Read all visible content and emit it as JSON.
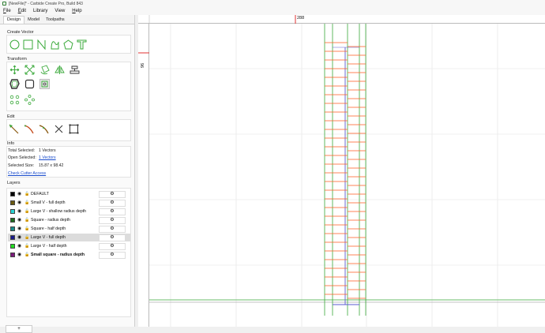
{
  "window": {
    "title": "[NewFile]* - Carbide Create Pro, Build 843"
  },
  "menu": [
    {
      "accel": "F",
      "rest": "ile"
    },
    {
      "accel": "E",
      "rest": "dit"
    },
    {
      "accel": "",
      "rest": "Library"
    },
    {
      "accel": "",
      "rest": "View"
    },
    {
      "accel": "H",
      "rest": "elp"
    }
  ],
  "tabs": [
    "Design",
    "Model",
    "Toolpaths"
  ],
  "sections": {
    "create_vector": "Create Vector",
    "transform": "Transform",
    "edit": "Edit",
    "info": "Info",
    "layers": "Layers"
  },
  "info": {
    "total_selected_label": "Total Selected:",
    "total_selected_value": "1 Vectors",
    "open_selected_label": "Open Selected:",
    "open_selected_value": "1 Vectors",
    "selected_size_label": "Selected Size:",
    "selected_size_value": "15.87 x 98.42",
    "check_cutter": "Check Cutter Access"
  },
  "layers": [
    {
      "name": "DEFAULT",
      "color": "#000000",
      "bold": false,
      "selected": false
    },
    {
      "name": "Small V - full depth",
      "color": "#6b5a10",
      "bold": false,
      "selected": false
    },
    {
      "name": "Large V - shallow radius depth",
      "color": "#2bd3d3",
      "bold": false,
      "selected": false
    },
    {
      "name": "Square - radius depth",
      "color": "#1e6b1e",
      "bold": false,
      "selected": false
    },
    {
      "name": "Square - half depth",
      "color": "#1a8a8a",
      "bold": false,
      "selected": false
    },
    {
      "name": "Large V - full depth",
      "color": "#1a1a8c",
      "bold": false,
      "selected": true
    },
    {
      "name": "Large V - half depth",
      "color": "#22dd22",
      "bold": false,
      "selected": false
    },
    {
      "name": "Small square - radius depth",
      "color": "#7a1a7a",
      "bold": true,
      "selected": false
    }
  ],
  "gear_icon": "gear-icon",
  "add_layer": "+",
  "rulers": {
    "top_label": "288",
    "left_label": "96"
  },
  "colors": {
    "accent_green": "#3aa93a",
    "cut_orange": "#ff5a1f",
    "marker_red": "#e03030"
  }
}
